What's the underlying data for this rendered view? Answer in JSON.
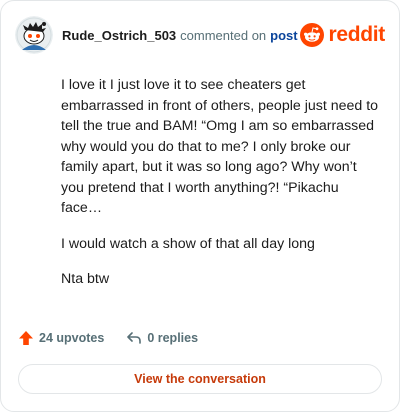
{
  "header": {
    "username": "Rude_Ostrich_503",
    "action_text": "commented on",
    "link_text": "post",
    "brand": "reddit"
  },
  "comment": {
    "paragraphs": [
      "I love it I just love it to see cheaters get embarrassed in front of others, people just need to tell the true and BAM! “Omg I am so embarrassed why would you do that to me? I only broke our family apart, but it was so long ago? Why won’t you pretend that I worth anything?! “Pikachu face…",
      "I would watch a show of that all day long",
      "Nta btw"
    ]
  },
  "footer": {
    "upvotes": "24 upvotes",
    "replies": "0 replies"
  },
  "cta": {
    "label": "View the conversation"
  },
  "colors": {
    "brand": "#ff4500",
    "link": "#0a449b",
    "muted": "#576f76",
    "cta_text": "#c63a0a"
  },
  "icons": {
    "avatar": "snoo-avatar",
    "brand": "reddit-logo-icon",
    "upvote": "upvote-arrow-icon",
    "reply": "reply-icon"
  }
}
